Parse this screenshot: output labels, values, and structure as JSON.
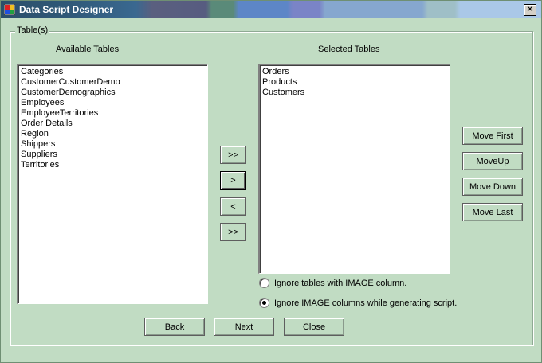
{
  "window": {
    "title": "Data Script Designer",
    "close_glyph": "✕"
  },
  "group": {
    "label": "Table(s)"
  },
  "available": {
    "label": "Available Tables",
    "items": [
      "Categories",
      "CustomerCustomerDemo",
      "CustomerDemographics",
      "Employees",
      "EmployeeTerritories",
      "Order Details",
      "Region",
      "Shippers",
      "Suppliers",
      "Territories"
    ]
  },
  "selected": {
    "label": "Selected Tables",
    "items": [
      "Orders",
      "Products",
      "Customers"
    ]
  },
  "transfer": {
    "add_all": ">>",
    "add": ">",
    "remove": "<",
    "remove_all": ">>"
  },
  "order": {
    "first": "Move First",
    "up": "MoveUp",
    "down": "Move Down",
    "last": "Move Last"
  },
  "options": {
    "ignore_tables": "Ignore tables with IMAGE column.",
    "ignore_columns": "Ignore IMAGE columns while generating script.",
    "selected": "ignore_columns"
  },
  "footer": {
    "back": "Back",
    "next": "Next",
    "close": "Close"
  }
}
